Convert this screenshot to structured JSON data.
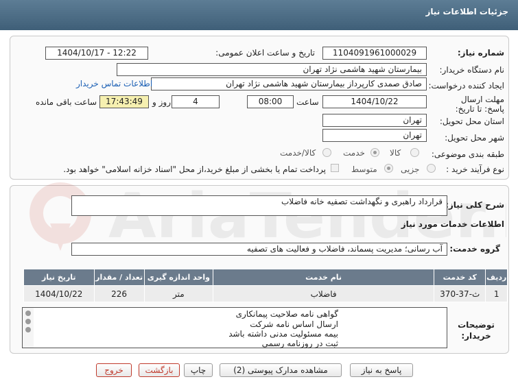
{
  "header": {
    "title": "جزئیات اطلاعات نیاز"
  },
  "fields": {
    "need_number_label": "شماره نیاز:",
    "need_number": "1104091961000029",
    "announce_label": "تاریخ و ساعت اعلان عمومی:",
    "announce_value": "1404/10/17 - 12:22",
    "buyer_org_label": "نام دستگاه خریدار:",
    "buyer_org": "بیمارستان شهید هاشمی نژاد تهران",
    "creator_label": "ایجاد کننده درخواست:",
    "creator": "صادق صمدی کارپرداز بیمارستان شهید هاشمی نژاد تهران",
    "contact_link": "اطلاعات تماس خریدار",
    "deadline_label": "مهلت ارسال پاسخ: تا تاریخ:",
    "deadline_date": "1404/10/22",
    "time_label": "ساعت",
    "deadline_time": "08:00",
    "days_value": "4",
    "days_label": "روز و",
    "remaining_time": "17:43:49",
    "remaining_label": "ساعت باقی مانده",
    "province_label": "استان محل تحویل:",
    "province": "تهران",
    "city_label": "شهر محل تحویل:",
    "city": "تهران",
    "category_label": "طبقه بندی موضوعی:",
    "category_options": [
      "کالا",
      "خدمت",
      "کالا/خدمت"
    ],
    "process_label": "نوع فرآیند خرید :",
    "process_options": [
      "جزیی",
      "متوسط"
    ],
    "payment_note": "پرداخت تمام یا بخشی از مبلغ خرید،از محل \"اسناد خزانه اسلامی\" خواهد بود."
  },
  "summary": {
    "label": "شرح کلی نیاز:",
    "value": "قرارداد راهبری و نگهداشت تصفیه خانه فاضلاب"
  },
  "services": {
    "section_title": "اطلاعات خدمات مورد نیاز",
    "group_label": "گروه خدمت:",
    "group_value": "آب رسانی؛ مدیریت پسماند، فاضلاب و فعالیت های تصفیه",
    "table": {
      "headers": [
        "ردیف",
        "کد خدمت",
        "نام خدمت",
        "واحد اندازه گیری",
        "تعداد / مقدار",
        "تاریخ نیاز"
      ],
      "rows": [
        [
          "1",
          "ث-37-370",
          "فاضلاب",
          "متر",
          "226",
          "1404/10/22"
        ]
      ]
    }
  },
  "buyer_notes": {
    "label": "توضیحات خریدار:",
    "lines": [
      "گواهی نامه صلاحیت پیمانکاری",
      "ارسال اساس نامه شرکت",
      "بیمه مسئولیت مدنی داشته باشد",
      "ثبت در روزنامه رسمی"
    ]
  },
  "buttons": {
    "reply": "پاسخ به نیاز",
    "docs": "مشاهده مدارک پیوستی (2)",
    "print": "چاپ",
    "back": "بازگشت",
    "exit": "خروج"
  },
  "watermark": {
    "text": "AriaTender.net"
  },
  "colors": {
    "titlebar": "#4a6a84",
    "table_header": "#6b7b8c",
    "highlight": "#f6f0b0",
    "link": "#1a5fb4"
  }
}
